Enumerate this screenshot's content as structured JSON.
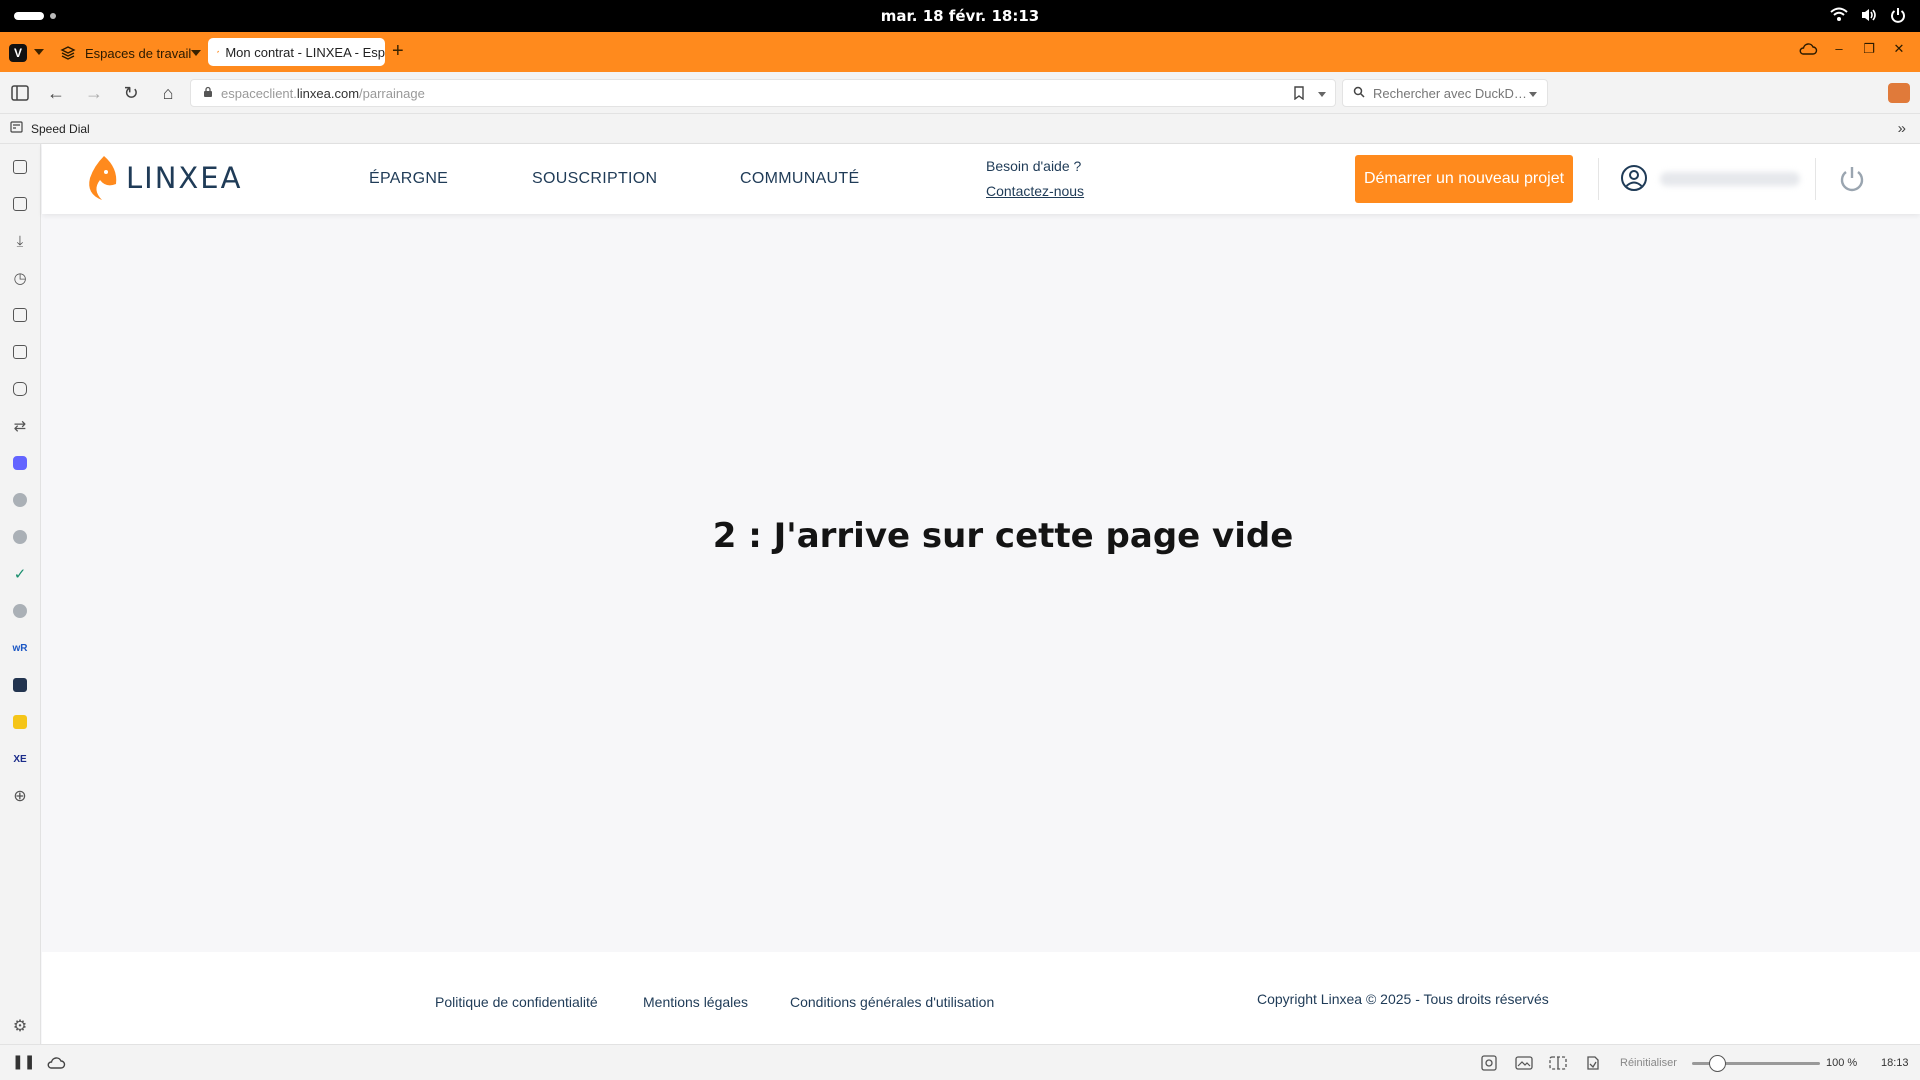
{
  "system": {
    "datetime": "mar. 18 févr.  18:13"
  },
  "browser": {
    "workspaces_label": "Espaces de travail",
    "tab_title": "Mon contrat - LINXEA - Esp",
    "new_tab": "+",
    "url": {
      "prefix": "espaceclient.",
      "domain": "linxea.com",
      "path": "/parrainage"
    },
    "search_placeholder": "Rechercher avec DuckD…",
    "bookmark": "Speed Dial",
    "status": {
      "reset_label": "Réinitialiser",
      "zoom": "100 %",
      "time": "18:13"
    }
  },
  "site": {
    "logo_text": "LINXEA",
    "nav": [
      "ÉPARGNE",
      "SOUSCRIPTION",
      "COMMUNAUTÉ"
    ],
    "help_question": "Besoin d'aide ?",
    "help_link": "Contactez-nous",
    "cta": "Démarrer un nouveau projet",
    "headline": "2 : J'arrive sur cette page vide",
    "footer": {
      "links": [
        "Politique de confidentialité",
        "Mentions légales",
        "Conditions générales d'utilisation"
      ],
      "copyright": "Copyright Linxea © 2025 - Tous droits réservés"
    }
  },
  "colors": {
    "brand_orange": "#ff8a1d",
    "navy": "#1f3b57"
  }
}
